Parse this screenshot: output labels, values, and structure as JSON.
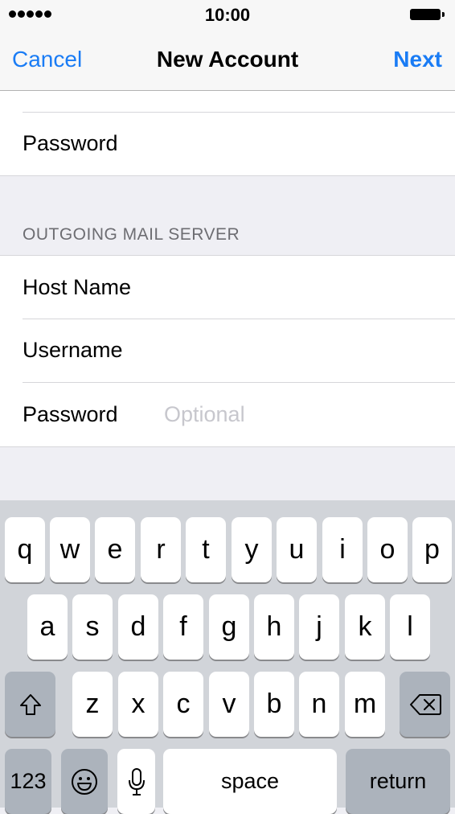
{
  "status": {
    "time": "10:00"
  },
  "nav": {
    "cancel": "Cancel",
    "title": "New Account",
    "next": "Next"
  },
  "form": {
    "password_label": "Password",
    "section_header": "OUTGOING MAIL SERVER",
    "host_label": "Host Name",
    "username_label": "Username",
    "out_password_label": "Password",
    "out_password_placeholder": "Optional"
  },
  "keyboard": {
    "row1": [
      "q",
      "w",
      "e",
      "r",
      "t",
      "y",
      "u",
      "i",
      "o",
      "p"
    ],
    "row2": [
      "a",
      "s",
      "d",
      "f",
      "g",
      "h",
      "j",
      "k",
      "l"
    ],
    "row3": [
      "z",
      "x",
      "c",
      "v",
      "b",
      "n",
      "m"
    ],
    "numbers": "123",
    "space": "space",
    "return": "return",
    "icons": {
      "shift": "shift-icon",
      "delete": "delete-icon",
      "emoji": "emoji-icon",
      "mic": "microphone-icon"
    }
  }
}
